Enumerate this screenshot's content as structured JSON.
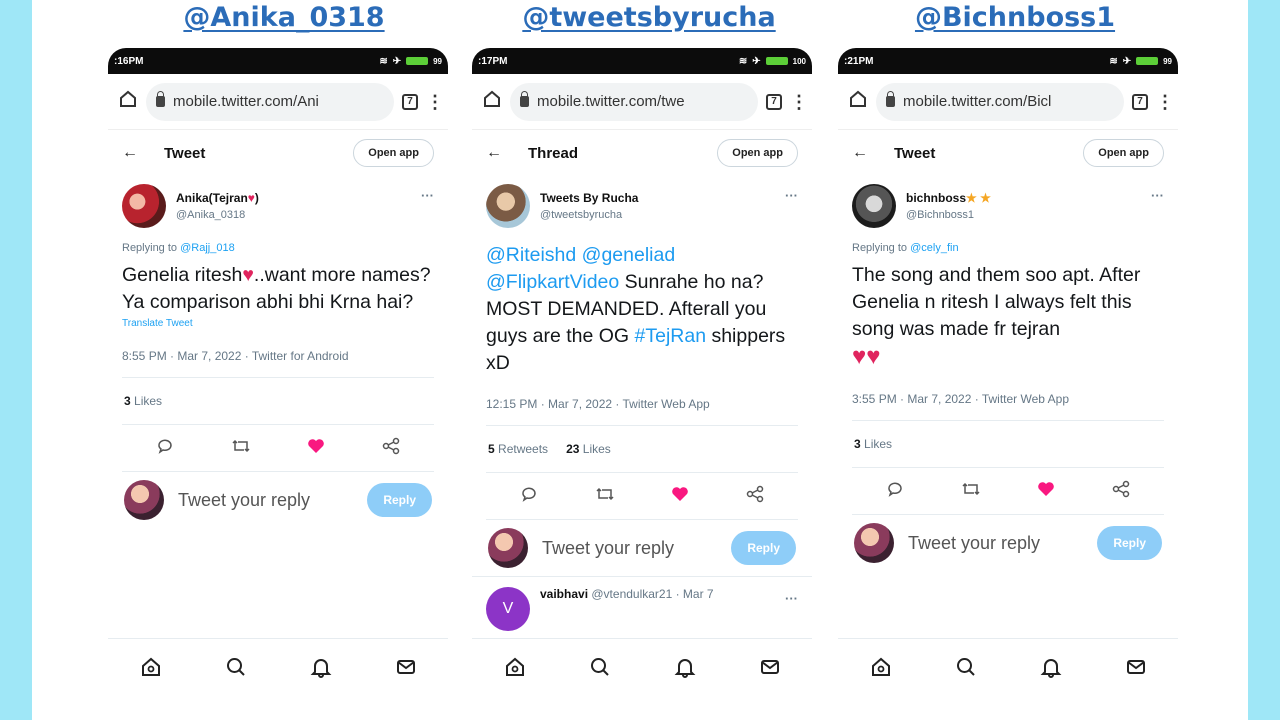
{
  "columns": [
    {
      "title": "@Anika_0318",
      "status_time": ":16PM",
      "battery": "99",
      "url": "mobile.twitter.com/Ani",
      "tab_count": "7",
      "header_title": "Tweet",
      "open_app": "Open app",
      "author_name": "Anika(Tejran",
      "author_name_suffix": ")",
      "author_handle": "@Anika_0318",
      "replying_prefix": "Replying to ",
      "replying_to": "@Rajj_018",
      "tweet_parts": [
        "Genelia ritesh",
        "..want more names? Ya comparison abhi bhi Krna hai?"
      ],
      "translate": "Translate Tweet",
      "timestamp": "8:55 PM · Mar 7, 2022 · Twitter for Android",
      "likes_count": "3",
      "likes_label": "Likes",
      "reply_placeholder": "Tweet your reply",
      "reply_button": "Reply"
    },
    {
      "title": "@tweetsbyrucha",
      "status_time": ":17PM",
      "battery": "100",
      "url": "mobile.twitter.com/twe",
      "tab_count": "7",
      "header_title": "Thread",
      "open_app": "Open app",
      "author_name": "Tweets By Rucha",
      "author_handle": "@tweetsbyrucha",
      "mentions": "@Riteishd @geneliad @FlipkartVideo",
      "tweet_body": " Sunrahe ho na? MOST DEMANDED. Afterall you guys are the OG ",
      "hashtag": "#TejRan",
      "tweet_tail": " shippers xD",
      "timestamp": "12:15 PM · Mar 7, 2022 · Twitter Web App",
      "retweets_count": "5",
      "retweets_label": "Retweets",
      "likes_count": "23",
      "likes_label": "Likes",
      "reply_placeholder": "Tweet your reply",
      "reply_button": "Reply",
      "next_name": "vaibhavi",
      "next_handle": "@vtendulkar21 · Mar 7",
      "next_initial": "V"
    },
    {
      "title": "@Bichnboss1",
      "status_time": ":21PM",
      "battery": "99",
      "url": "mobile.twitter.com/Bicl",
      "tab_count": "7",
      "header_title": "Tweet",
      "open_app": "Open app",
      "author_name": "bichnboss",
      "author_handle": "@Bichnboss1",
      "replying_prefix": "Replying to ",
      "replying_to": "@cely_fin",
      "tweet_text": "The song and them soo apt. After Genelia n ritesh I always felt this song was made fr tejran",
      "timestamp": "3:55 PM · Mar 7, 2022 · Twitter Web App",
      "likes_count": "3",
      "likes_label": "Likes",
      "reply_placeholder": "Tweet your reply",
      "reply_button": "Reply"
    }
  ],
  "colors": {
    "background": "#9fe7f7",
    "title": "#2b6cb8",
    "link": "#1d9bf0",
    "heart": "#e0245e",
    "reply_button": "#8ecdf8"
  },
  "icons": [
    "home-icon",
    "lock-icon",
    "tabs-icon",
    "kebab-icon",
    "back-icon",
    "reply-icon",
    "retweet-icon",
    "like-icon",
    "share-icon",
    "search-icon",
    "notifications-icon",
    "messages-icon"
  ]
}
